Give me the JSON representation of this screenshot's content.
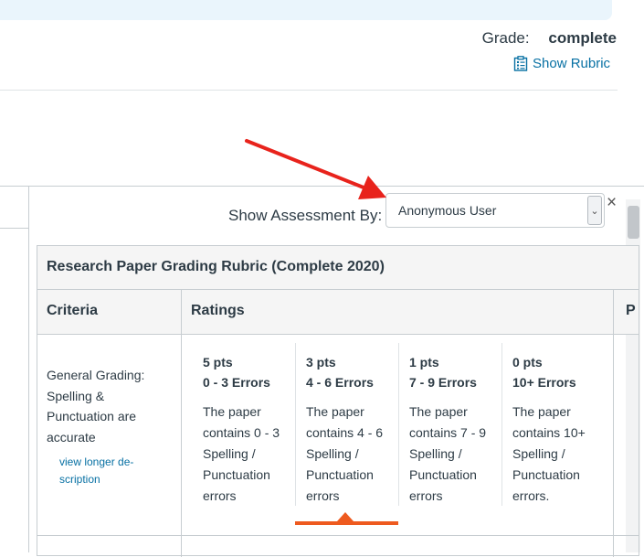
{
  "grade": {
    "label": "Grade:",
    "value": "complete"
  },
  "show_rubric": {
    "label": "Show Rubric",
    "icon": "rubric-icon"
  },
  "assessment": {
    "label": "Show Assessment By:",
    "selected": "Anonymous User"
  },
  "rubric": {
    "title": "Research Paper Grading Rubric (Complete 2020)",
    "columns": {
      "criteria": "Criteria",
      "ratings": "Ratings",
      "pts": "P"
    },
    "criterion": {
      "description": "General Grading: Spelling & Punctuation are accurate",
      "long_description_link": "view longer de­scription",
      "ratings": [
        {
          "points": "5 pts",
          "description": "0 - 3 Errors",
          "long": "The paper contains 0 - 3 Spelling / Punctuation errors"
        },
        {
          "points": "3 pts",
          "description": "4 - 6 Errors",
          "long": "The paper contains 4 - 6 Spelling / Punctuation errors"
        },
        {
          "points": "1 pts",
          "description": "7 - 9 Errors",
          "long": "The paper contains 7 - 9 Spelling / Punctuation errors"
        },
        {
          "points": "0 pts",
          "description": "10+ Errors",
          "long": "The paper contains 10+ Spelling / Punctuation errors."
        }
      ],
      "selected_rating": 1
    }
  },
  "colors": {
    "link": "#0770a3",
    "selected_rating": "#ee5a1f",
    "annotation_arrow": "#e8231c",
    "banner": "#eaf5fc"
  }
}
